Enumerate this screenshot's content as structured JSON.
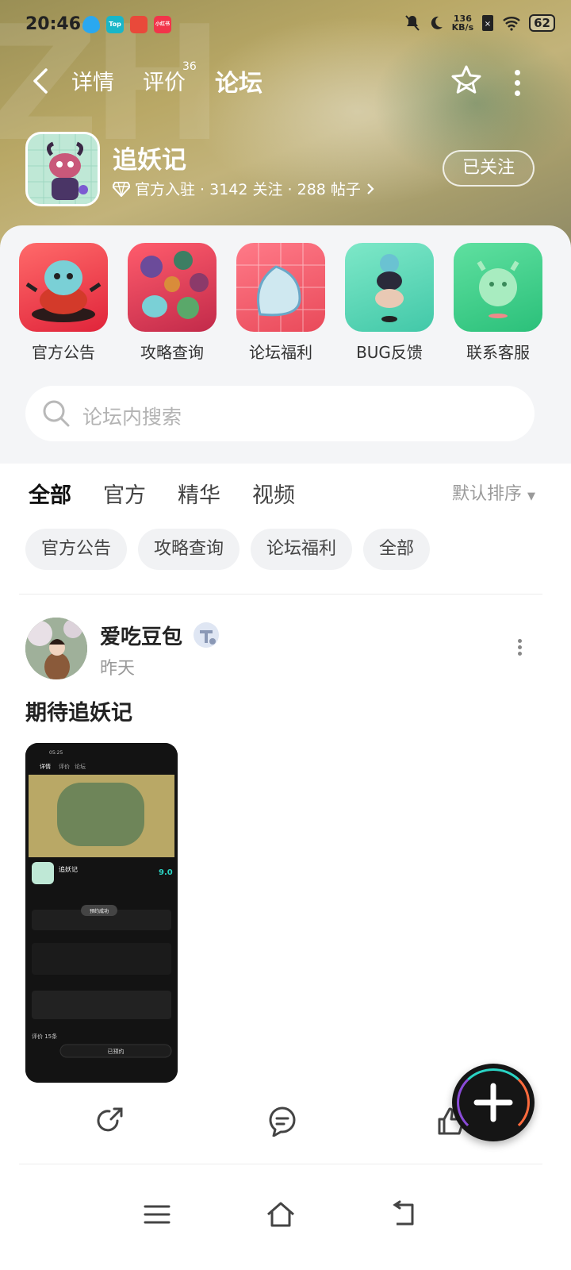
{
  "status_bar": {
    "time": "20:46",
    "app_badges": [
      "Top",
      "小红书"
    ],
    "net_speed_value": "136",
    "net_speed_unit": "KB/s",
    "battery": "62"
  },
  "nav": {
    "tabs": [
      {
        "label": "详情"
      },
      {
        "label": "评价",
        "badge": "36"
      },
      {
        "label": "论坛"
      }
    ]
  },
  "game": {
    "name": "追妖记",
    "meta": "官方入驻 · 3142 关注 · 288 帖子",
    "follow_label": "已关注"
  },
  "shortcuts": [
    {
      "label": "官方公告"
    },
    {
      "label": "攻略查询"
    },
    {
      "label": "论坛福利"
    },
    {
      "label": "BUG反馈"
    },
    {
      "label": "联系客服"
    }
  ],
  "search": {
    "placeholder": "论坛内搜索"
  },
  "filter_tabs": [
    {
      "label": "全部"
    },
    {
      "label": "官方"
    },
    {
      "label": "精华"
    },
    {
      "label": "视频"
    }
  ],
  "sort_label": "默认排序",
  "chips": [
    {
      "label": "官方公告"
    },
    {
      "label": "攻略查询"
    },
    {
      "label": "论坛福利"
    },
    {
      "label": "全部"
    }
  ],
  "post": {
    "author": "爱吃豆包",
    "time": "昨天",
    "title": "期待追妖记",
    "screenshot": {
      "time": "05:25",
      "tabs": [
        "详情",
        "评价",
        "论坛"
      ],
      "game_name": "追妖记",
      "score": "9.0",
      "toast": "预约成功",
      "button": "已预约",
      "rating_label": "评价 15条"
    }
  },
  "colors": {
    "accent": "#20c7b2",
    "banner": "#b9a866"
  }
}
